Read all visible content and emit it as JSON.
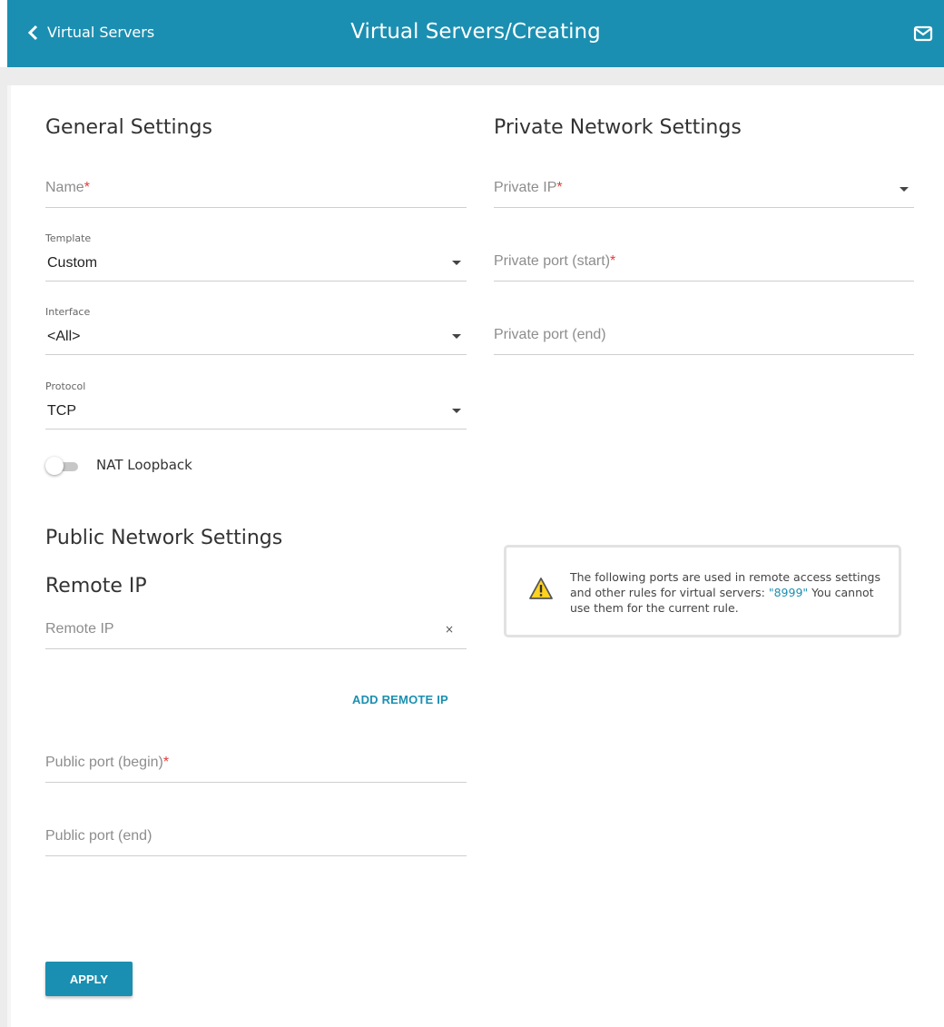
{
  "header": {
    "back_label": "Virtual Servers",
    "title": "Virtual Servers/Creating",
    "back_icon": "chevron-left-icon",
    "mail_icon": "mail-icon",
    "color": "#1b8fb1"
  },
  "general": {
    "title": "General Settings",
    "name_placeholder": "Name",
    "template_label": "Template",
    "template_value": "Custom",
    "interface_label": "Interface",
    "interface_value": "<All>",
    "protocol_label": "Protocol",
    "protocol_value": "TCP",
    "nat_loopback_label": "NAT Loopback",
    "nat_loopback_enabled": false
  },
  "public": {
    "title": "Public Network Settings",
    "remote_ip_title": "Remote IP",
    "remote_ip_placeholder": "Remote IP",
    "clear_symbol": "×",
    "add_remote_ip_label": "ADD REMOTE IP",
    "port_begin_placeholder": "Public port (begin)",
    "port_end_placeholder": "Public port (end)"
  },
  "private": {
    "title": "Private Network Settings",
    "ip_placeholder": "Private IP",
    "port_start_placeholder": "Private port (start)",
    "port_end_placeholder": "Private port (end)"
  },
  "notice": {
    "icon": "warning-icon",
    "text_before": "The following ports are used in remote access settings and other rules for virtual servers: ",
    "ports": "\"8999\"",
    "text_after": " You cannot use them for the current rule."
  },
  "required_mark": "*",
  "apply_label": "APPLY"
}
